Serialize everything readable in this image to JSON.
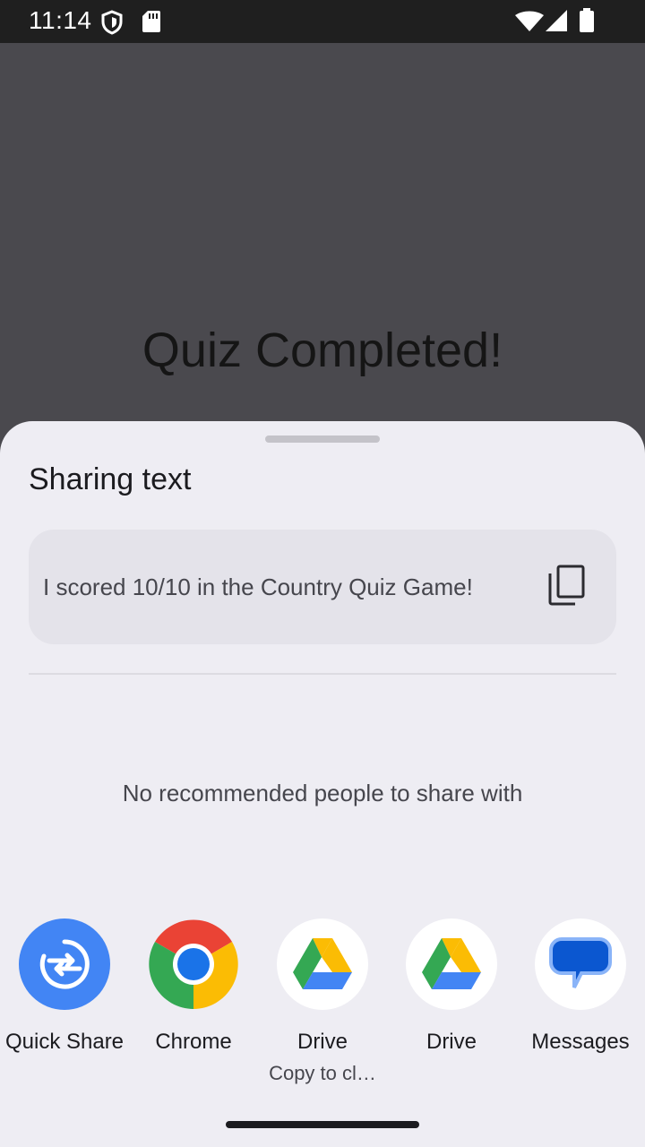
{
  "status_bar": {
    "time": "11:14",
    "icons": [
      "shield-icon",
      "sd-card-icon",
      "wifi-icon",
      "signal-icon",
      "battery-icon"
    ]
  },
  "app": {
    "title": "Quiz Completed!"
  },
  "share_sheet": {
    "title": "Sharing text",
    "preview_text": "I scored 10/10 in the Country Quiz Game!",
    "copy_icon": "copy-icon",
    "empty_message": "No recommended people to share with",
    "targets": [
      {
        "label": "Quick Share",
        "icon": "quick-share-icon",
        "color": "#4285f4"
      },
      {
        "label": "Chrome",
        "icon": "chrome-icon"
      },
      {
        "label": "Drive",
        "sublabel": "Copy to cl…",
        "icon": "drive-icon"
      },
      {
        "label": "Drive",
        "icon": "drive-icon"
      },
      {
        "label": "Messages",
        "icon": "messages-icon",
        "color": "#0b57d0"
      }
    ]
  }
}
